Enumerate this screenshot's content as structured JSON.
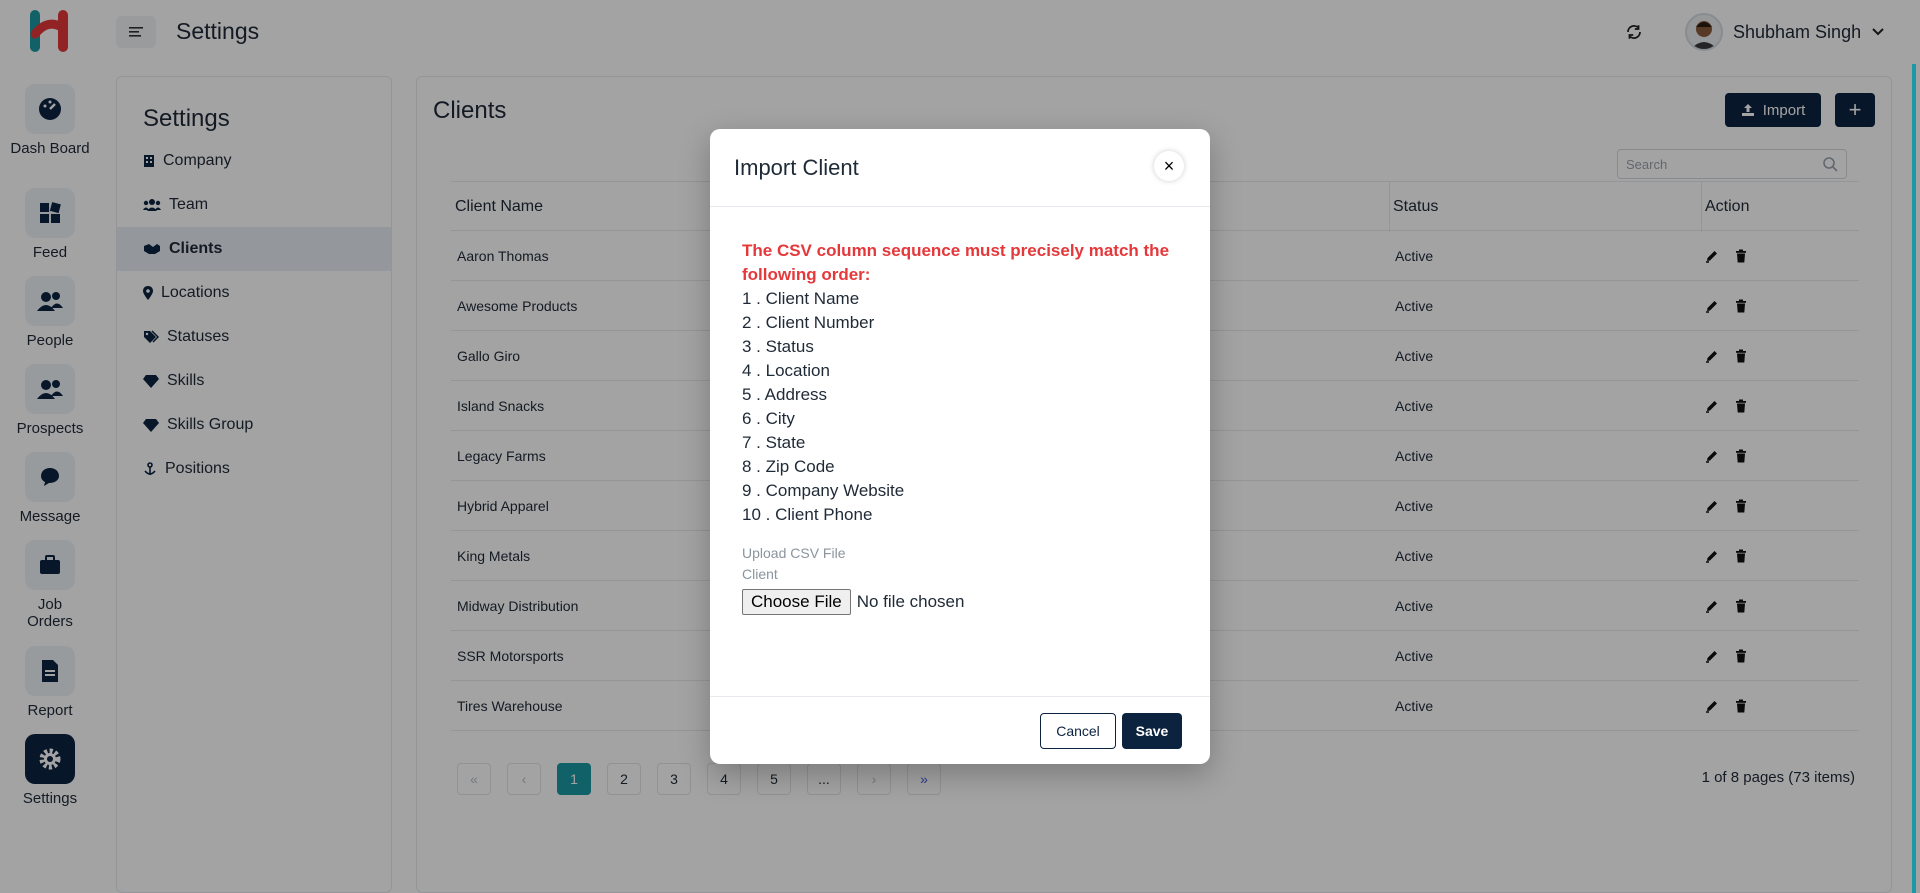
{
  "header": {
    "title": "Settings",
    "user_name": "Shubham Singh",
    "icons": {
      "menu": "menu-icon",
      "refresh": "refresh-icon",
      "chevron": "chevron-down-icon"
    }
  },
  "rail": {
    "items": [
      {
        "label": "Dash Board",
        "icon": "dashboard-icon"
      },
      {
        "label": "Feed",
        "icon": "feed-icon"
      },
      {
        "label": "People",
        "icon": "people-icon"
      },
      {
        "label": "Prospects",
        "icon": "prospects-icon"
      },
      {
        "label": "Message",
        "icon": "message-icon"
      },
      {
        "label": "Job Orders",
        "icon": "briefcase-icon"
      },
      {
        "label": "Report",
        "icon": "report-icon"
      },
      {
        "label": "Settings",
        "icon": "gear-icon"
      }
    ]
  },
  "settings_menu": {
    "title": "Settings",
    "items": [
      {
        "label": "Company",
        "icon": "building-icon"
      },
      {
        "label": "Team",
        "icon": "team-icon"
      },
      {
        "label": "Clients",
        "icon": "handshake-icon"
      },
      {
        "label": "Locations",
        "icon": "map-pin-icon"
      },
      {
        "label": "Statuses",
        "icon": "tags-icon"
      },
      {
        "label": "Skills",
        "icon": "gem-icon"
      },
      {
        "label": "Skills Group",
        "icon": "gem-icon"
      },
      {
        "label": "Positions",
        "icon": "anchor-icon"
      }
    ]
  },
  "main": {
    "title": "Clients",
    "import_label": "Import",
    "add_label": "+",
    "search_placeholder": "Search",
    "columns": [
      "Client Name",
      "Status",
      "Action"
    ],
    "rows": [
      {
        "name": "Aaron Thomas",
        "status": "Active"
      },
      {
        "name": "Awesome Products",
        "status": "Active"
      },
      {
        "name": "Gallo Giro",
        "status": "Active"
      },
      {
        "name": "Island Snacks",
        "status": "Active"
      },
      {
        "name": "Legacy Farms",
        "status": "Active"
      },
      {
        "name": "Hybrid Apparel",
        "status": "Active"
      },
      {
        "name": "King Metals",
        "status": "Active"
      },
      {
        "name": "Midway Distribution",
        "status": "Active"
      },
      {
        "name": "SSR Motorsports",
        "status": "Active"
      },
      {
        "name": "Tires Warehouse",
        "status": "Active"
      }
    ],
    "pagination": {
      "first": "«",
      "prev": "‹",
      "pages": [
        "1",
        "2",
        "3",
        "4",
        "5",
        "..."
      ],
      "next": "›",
      "last": "»",
      "info": "1 of 8 pages (73 items)"
    }
  },
  "modal": {
    "title": "Import Client",
    "close": "×",
    "notice": "The CSV column sequence must precisely match the following order:",
    "order": [
      "1 . Client Name",
      "2 . Client Number",
      "3 . Status",
      "4 . Location",
      "5 . Address",
      "6 . City",
      "7 . State",
      "8 . Zip Code",
      "9 . Company Website",
      "10 . Client Phone"
    ],
    "upload_label": "Upload CSV File",
    "upload_sublabel": "Client",
    "choose_file": "Choose File",
    "no_file": "No file chosen",
    "cancel": "Cancel",
    "save": "Save"
  },
  "colors": {
    "primary": "#0c2340",
    "accent": "#1b9aa3",
    "danger": "#e5383b"
  }
}
